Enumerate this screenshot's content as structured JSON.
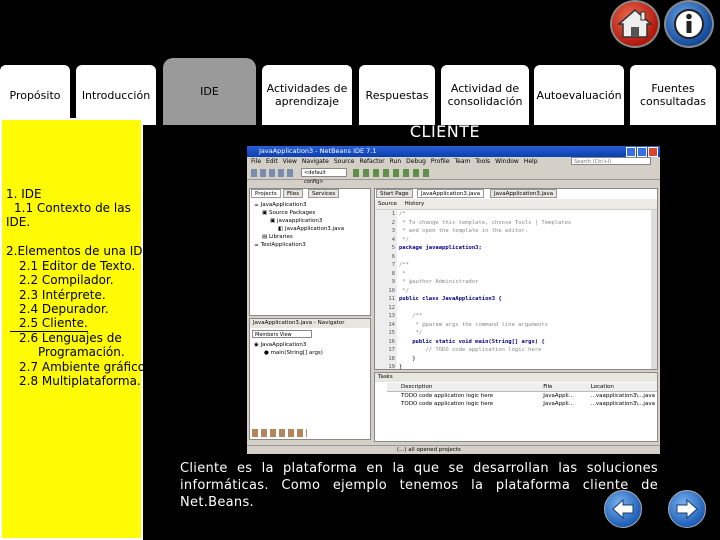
{
  "nav_tabs": [
    {
      "label": "Propósito"
    },
    {
      "label": "Introducción"
    },
    {
      "label": "IDE"
    },
    {
      "label": "Actividades de aprendizaje"
    },
    {
      "label": "Respuestas"
    },
    {
      "label": "Actividad de consolidación"
    },
    {
      "label": "Autoevaluación"
    },
    {
      "label": "Fuentes consultadas"
    }
  ],
  "top_icons": {
    "home": "home-icon",
    "info": "info-icon"
  },
  "sidebar": {
    "lines": [
      "1. IDE",
      "1.1 Contexto de  las",
      "IDE.",
      "2.Elementos de una IDE.",
      "2.1 Editor de Texto.",
      "2.2 Compilador.",
      "2.3 Intérprete.",
      "2.4 Depurador.",
      "2.5 Cliente.",
      "2.6 Lenguajes de",
      "Programación.",
      "2.7 Ambiente gráfico.",
      "2.8 Multiplataforma."
    ]
  },
  "main": {
    "title": "CLIENTE",
    "description": "Cliente es la plataforma en la que se desarrollan las soluciones informáticas. Como ejemplo tenemos la plataforma cliente de Net.Beans."
  },
  "ide": {
    "window_title": "JavaApplication3 - NetBeans IDE 7.1",
    "menu": [
      "File",
      "Edit",
      "View",
      "Navigate",
      "Source",
      "Refactor",
      "Run",
      "Debug",
      "Profile",
      "Team",
      "Tools",
      "Window",
      "Help"
    ],
    "search_placeholder": "Search (Ctrl+I)",
    "config": "<default config>",
    "left_tabs": [
      "Projects",
      "Files",
      "Services"
    ],
    "tree": [
      "JavaApplication3",
      "Source Packages",
      "javaapplication3",
      "JavaApplication3.java",
      "Libraries",
      "TestApplication3"
    ],
    "nav_title": "JavaApplication3.java - Navigator",
    "nav_filter": "Members View",
    "nav_tree": [
      "JavaApplication3",
      "main(String[] args)"
    ],
    "editor_tabs": [
      "Start Page",
      "JavaApplication3.java",
      "JavaApplication3.java"
    ],
    "editor_toolbar": [
      "Source",
      "History"
    ],
    "code_lines": [
      "/*",
      " * To change this template, choose Tools | Templates",
      " * and open the template in the editor.",
      " */",
      "package javaapplication3;",
      "",
      "/**",
      " *",
      " * @author Administrador",
      " */",
      "public class JavaApplication3 {",
      "",
      "    /**",
      "     * @param args the command line arguments",
      "     */",
      "    public static void main(String[] args) {",
      "        // TODO code application logic here",
      "    }",
      "}"
    ],
    "tasks_title": "Tasks",
    "tasks_headers": [
      "Description",
      "File",
      "Location"
    ],
    "tasks_rows": [
      [
        "TODO code application logic here",
        "JavaAppli...",
        "...vaapplication3\\...java"
      ],
      [
        "TODO code application logic here",
        "JavaAppli...",
        "...vaapplication3\\...java"
      ]
    ],
    "status": "(...) all opened projects"
  },
  "bottom_nav": {
    "back": "arrow-left-icon",
    "forward": "arrow-right-icon"
  },
  "colors": {
    "sidebar": "#fffb05",
    "accent_red": "#c0281c",
    "accent_blue": "#1f5fb8"
  }
}
